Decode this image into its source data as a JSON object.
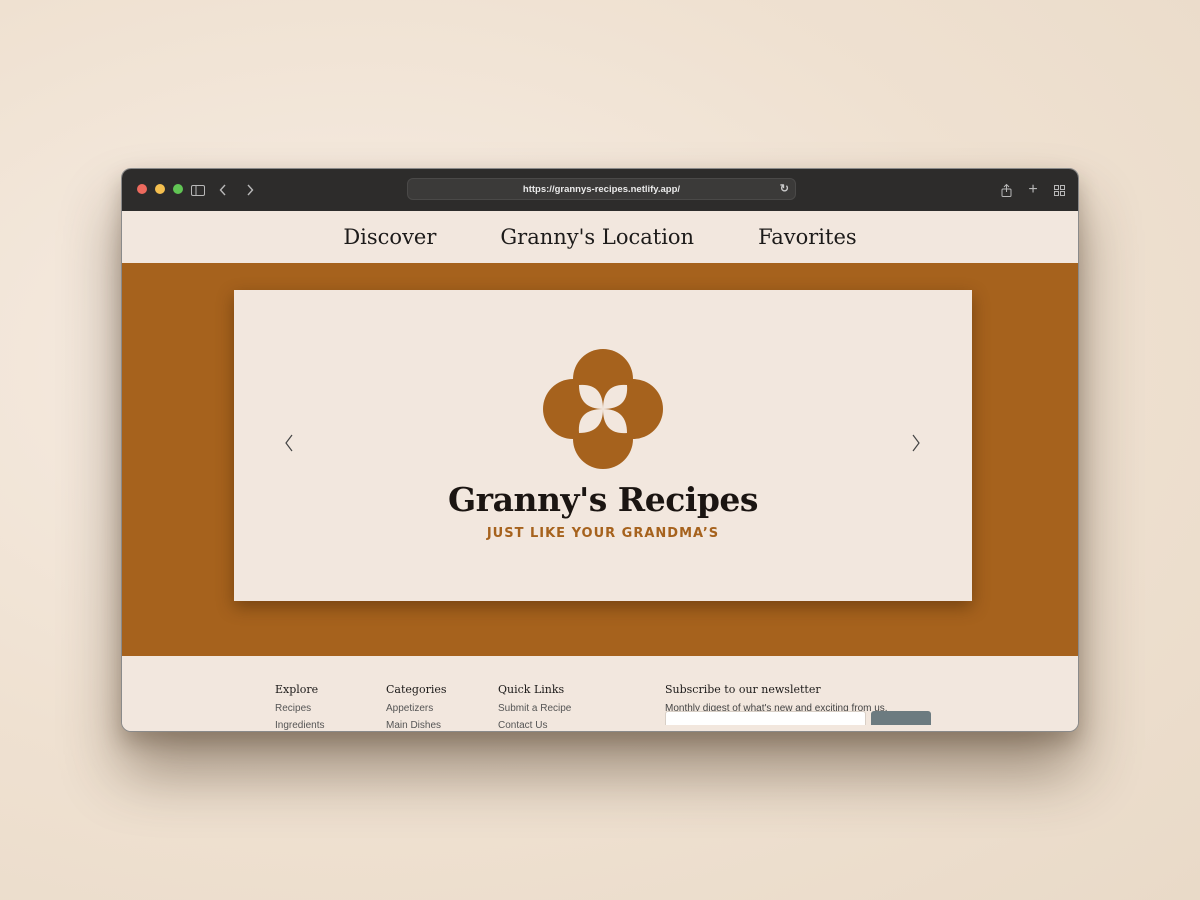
{
  "browser": {
    "url": "https://grannys-recipes.netlify.app/"
  },
  "nav": {
    "items": [
      "Discover",
      "Granny's Location",
      "Favorites"
    ]
  },
  "hero": {
    "brand_name": "Granny's Recipes",
    "tagline": "JUST LIKE YOUR GRANDMA’S",
    "accent_color": "#a6621d"
  },
  "footer": {
    "columns": [
      {
        "title": "Explore",
        "links": [
          "Recipes",
          "Ingredients"
        ]
      },
      {
        "title": "Categories",
        "links": [
          "Appetizers",
          "Main Dishes"
        ]
      },
      {
        "title": "Quick Links",
        "links": [
          "Submit a Recipe",
          "Contact Us"
        ]
      }
    ],
    "newsletter": {
      "title": "Subscribe to our newsletter",
      "description": "Monthly digest of what's new and exciting from us."
    }
  }
}
